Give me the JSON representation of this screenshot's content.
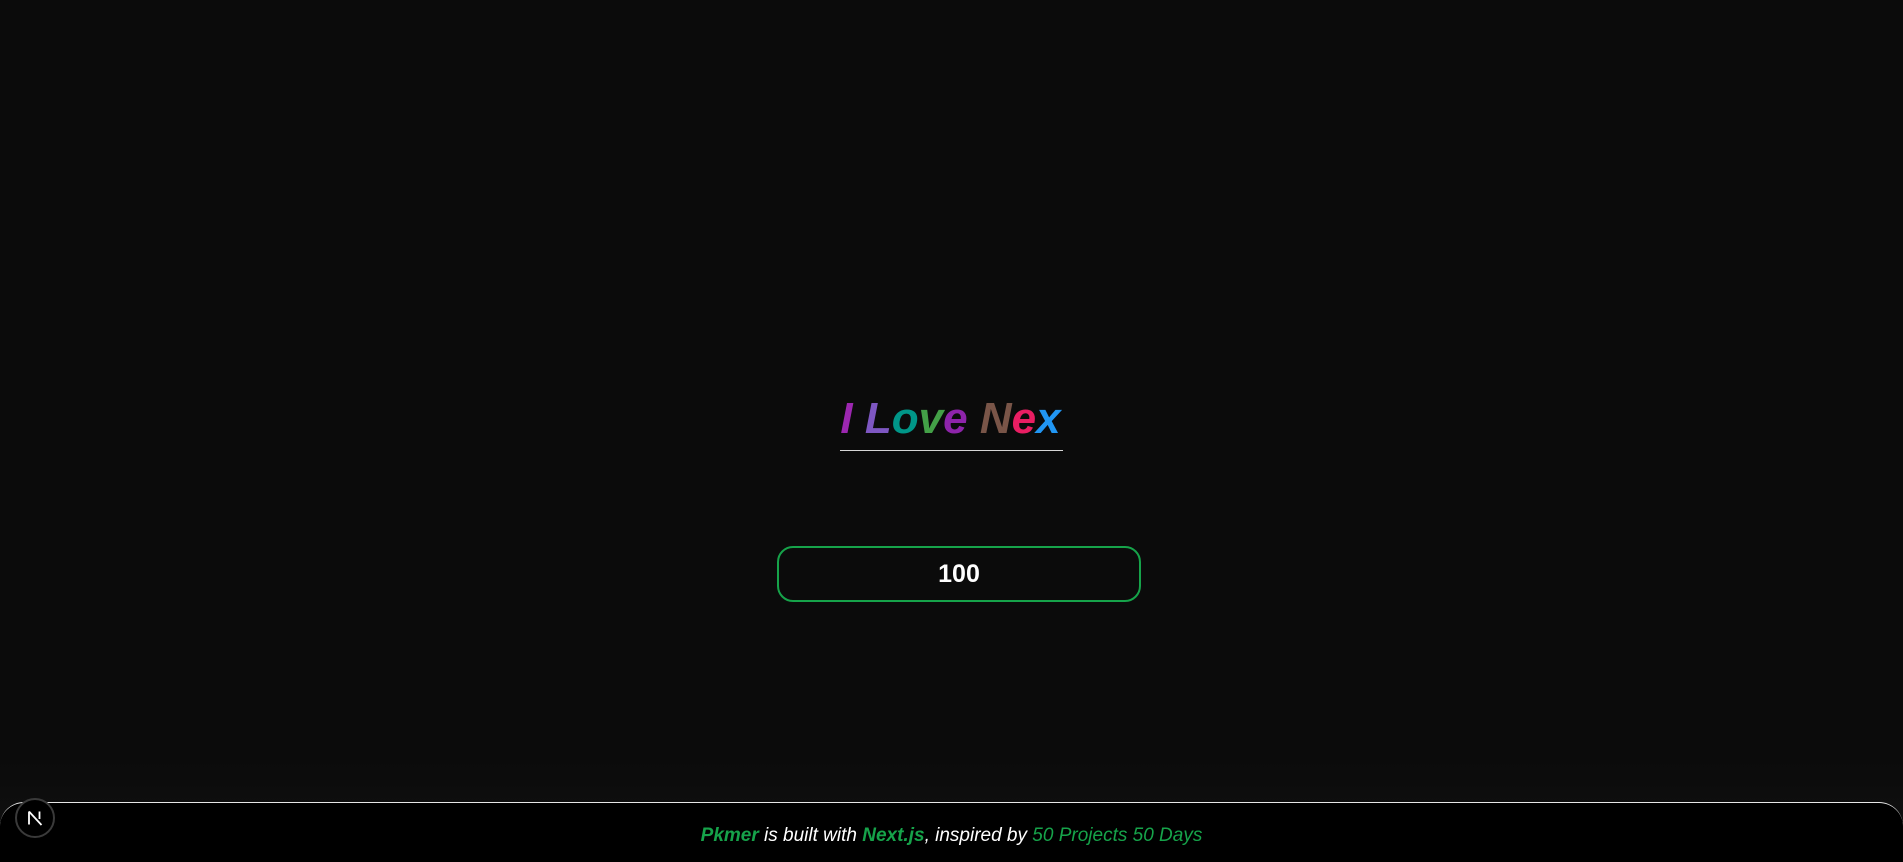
{
  "heading": {
    "letters": [
      {
        "char": "I",
        "color": "#9c27b0"
      },
      {
        "char": " ",
        "color": "#ffffff"
      },
      {
        "char": "L",
        "color": "#7e57c2"
      },
      {
        "char": "o",
        "color": "#009688"
      },
      {
        "char": "v",
        "color": "#43a047"
      },
      {
        "char": "e",
        "color": "#8e24aa"
      },
      {
        "char": " ",
        "color": "#ffffff"
      },
      {
        "char": "N",
        "color": "#795548"
      },
      {
        "char": "e",
        "color": "#e91e63"
      },
      {
        "char": "x",
        "color": "#2196f3"
      }
    ]
  },
  "counter": {
    "value": "100",
    "border_color": "#16a34a"
  },
  "footer": {
    "brand": "Pkmer",
    "text1": " is built with ",
    "framework": "Next.js",
    "text2": ", inspired by ",
    "inspiration": "50 Projects 50 Days",
    "accent_color": "#16a34a"
  },
  "badge": {
    "icon": "nextjs-logo-icon"
  }
}
